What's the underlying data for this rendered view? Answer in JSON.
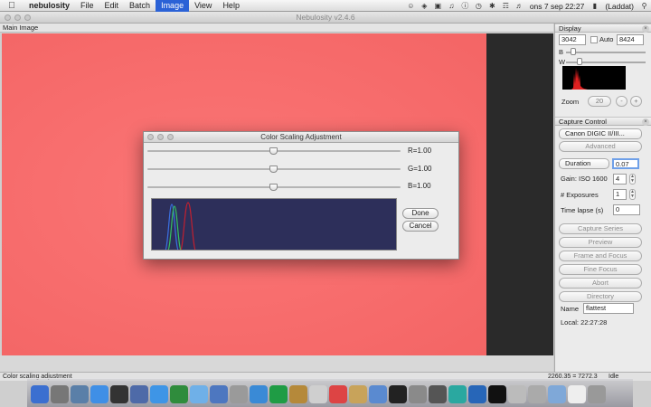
{
  "menubar": {
    "app_name": "nebulosity",
    "items": [
      "File",
      "Edit",
      "Batch",
      "Image",
      "View",
      "Help"
    ],
    "active_item": "Image",
    "clock": "ons 7 sep  22:27",
    "battery": "(Laddat)"
  },
  "window": {
    "title": "Nebulosity v2.4.6"
  },
  "main_panel": {
    "title": "Main Image"
  },
  "display": {
    "title": "Display",
    "black_value": "3042",
    "white_value": "8424",
    "auto_label": "Auto",
    "b_label": "B",
    "w_label": "W",
    "zoom_label": "Zoom",
    "zoom_value": "20",
    "zoom_minus": "-",
    "zoom_plus": "+"
  },
  "capture": {
    "title": "Capture Control",
    "camera": "Canon DIGIC II/III...",
    "advanced": "Advanced",
    "duration_label": "Duration",
    "duration_value": "0.07",
    "gain_label": "Gain: ISO 1600",
    "gain_value": "4",
    "exposures_label": "# Exposures",
    "exposures_value": "1",
    "timelapse_label": "Time lapse (s)",
    "timelapse_value": "0",
    "buttons": [
      "Capture Series",
      "Preview",
      "Frame and Focus",
      "Fine Focus",
      "Abort",
      "Directory"
    ],
    "name_label": "Name",
    "name_value": "flattest",
    "local_time": "Local: 22:27:28"
  },
  "dialog": {
    "title": "Color Scaling Adjustment",
    "r_label": "R=1.00",
    "g_label": "G=1.00",
    "b_label": "B=1.00",
    "r_value": 1.0,
    "g_value": 1.0,
    "b_value": 1.0,
    "done": "Done",
    "cancel": "Cancel"
  },
  "statusbar": {
    "message": "Color scaling adjustment",
    "coords": "2260,35 = 7272,3",
    "state": "Idle"
  },
  "colors": {
    "image_fill": "#f86e6e",
    "menu_active": "#2b62d6",
    "histogram_bg": "#2d2f5a"
  }
}
